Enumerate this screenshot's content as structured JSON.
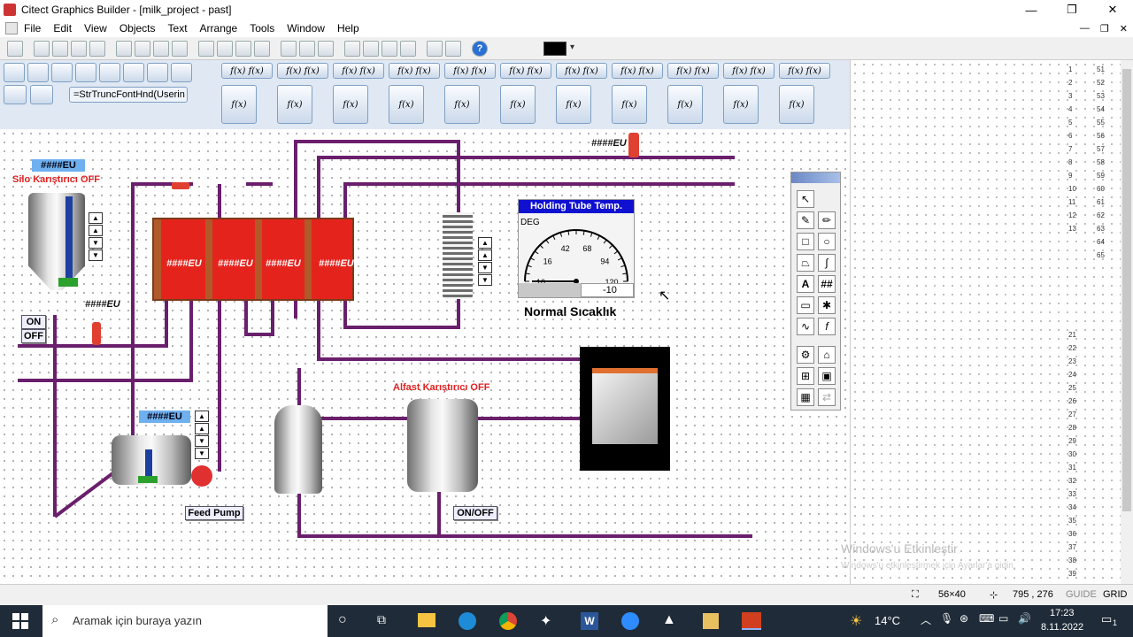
{
  "window": {
    "title": "Citect Graphics Builder - [milk_project - past]",
    "min": "—",
    "restore": "❐",
    "close": "✕"
  },
  "menu": [
    "File",
    "Edit",
    "View",
    "Objects",
    "Text",
    "Arrange",
    "Tools",
    "Window",
    "Help"
  ],
  "mdi_buttons": {
    "min": "—",
    "restore": "❐",
    "close": "✕"
  },
  "genie": {
    "input_value": "=StrTruncFontHnd(Userin",
    "fx": "f(x)"
  },
  "canvas": {
    "silo_eu": "####EU",
    "silo_label": "Silo Karıştırıcı OFF",
    "silo_level_eu": "####EU",
    "on": "ON",
    "off": "OFF",
    "hx_eu": [
      "####EU",
      "####EU",
      "####EU",
      "####EU"
    ],
    "top_eu": "####EU",
    "balance_eu": "####EU",
    "feed_pump": "Feed Pump",
    "alfast_label": "Alfast Karıştırıcı OFF",
    "alfast_onoff": "ON/OFF",
    "gauge": {
      "title": "Holding Tube Temp.",
      "unit": "DEG",
      "ticks": [
        "10",
        "16",
        "42",
        "68",
        "94",
        "120"
      ],
      "readout": "-10",
      "value": -10,
      "min": 10,
      "max": 120
    },
    "status": "Normal Sıcaklık"
  },
  "palette": {
    "tools": [
      "pointer",
      "freehand",
      "pencil",
      "rectangle",
      "ellipse",
      "polygon",
      "pipe",
      "text",
      "number",
      "button",
      "symbol-set",
      "trend",
      "genie",
      "symbol",
      "cicode",
      "database",
      "table",
      "image"
    ]
  },
  "right_numbers_a": [
    "51",
    "52",
    "53",
    "54",
    "55",
    "56",
    "57",
    "58",
    "59",
    "60",
    "61",
    "62",
    "63",
    "64",
    "65"
  ],
  "right_numbers_b": [
    "1",
    "2",
    "3",
    "4",
    "5",
    "6",
    "7",
    "8",
    "9",
    "10",
    "11",
    "12",
    "13"
  ],
  "right_numbers_c": [
    "21",
    "22",
    "23",
    "24",
    "25",
    "26",
    "27",
    "28",
    "29",
    "30",
    "31",
    "32",
    "33",
    "34",
    "35",
    "36",
    "37",
    "38",
    "39"
  ],
  "watermark": {
    "line1": "Windows'u Etkinleştir",
    "line2": "Windows'u etkinleştirmek için Ayarlar'a gidin."
  },
  "status": {
    "size": "56×40",
    "position": "795 , 276",
    "guide": "GUIDE",
    "grid": "GRID"
  },
  "taskbar": {
    "search_placeholder": "Aramak için buraya yazın",
    "temp": "14°C",
    "time": "17:23",
    "date": "8.11.2022",
    "notif": "1"
  }
}
